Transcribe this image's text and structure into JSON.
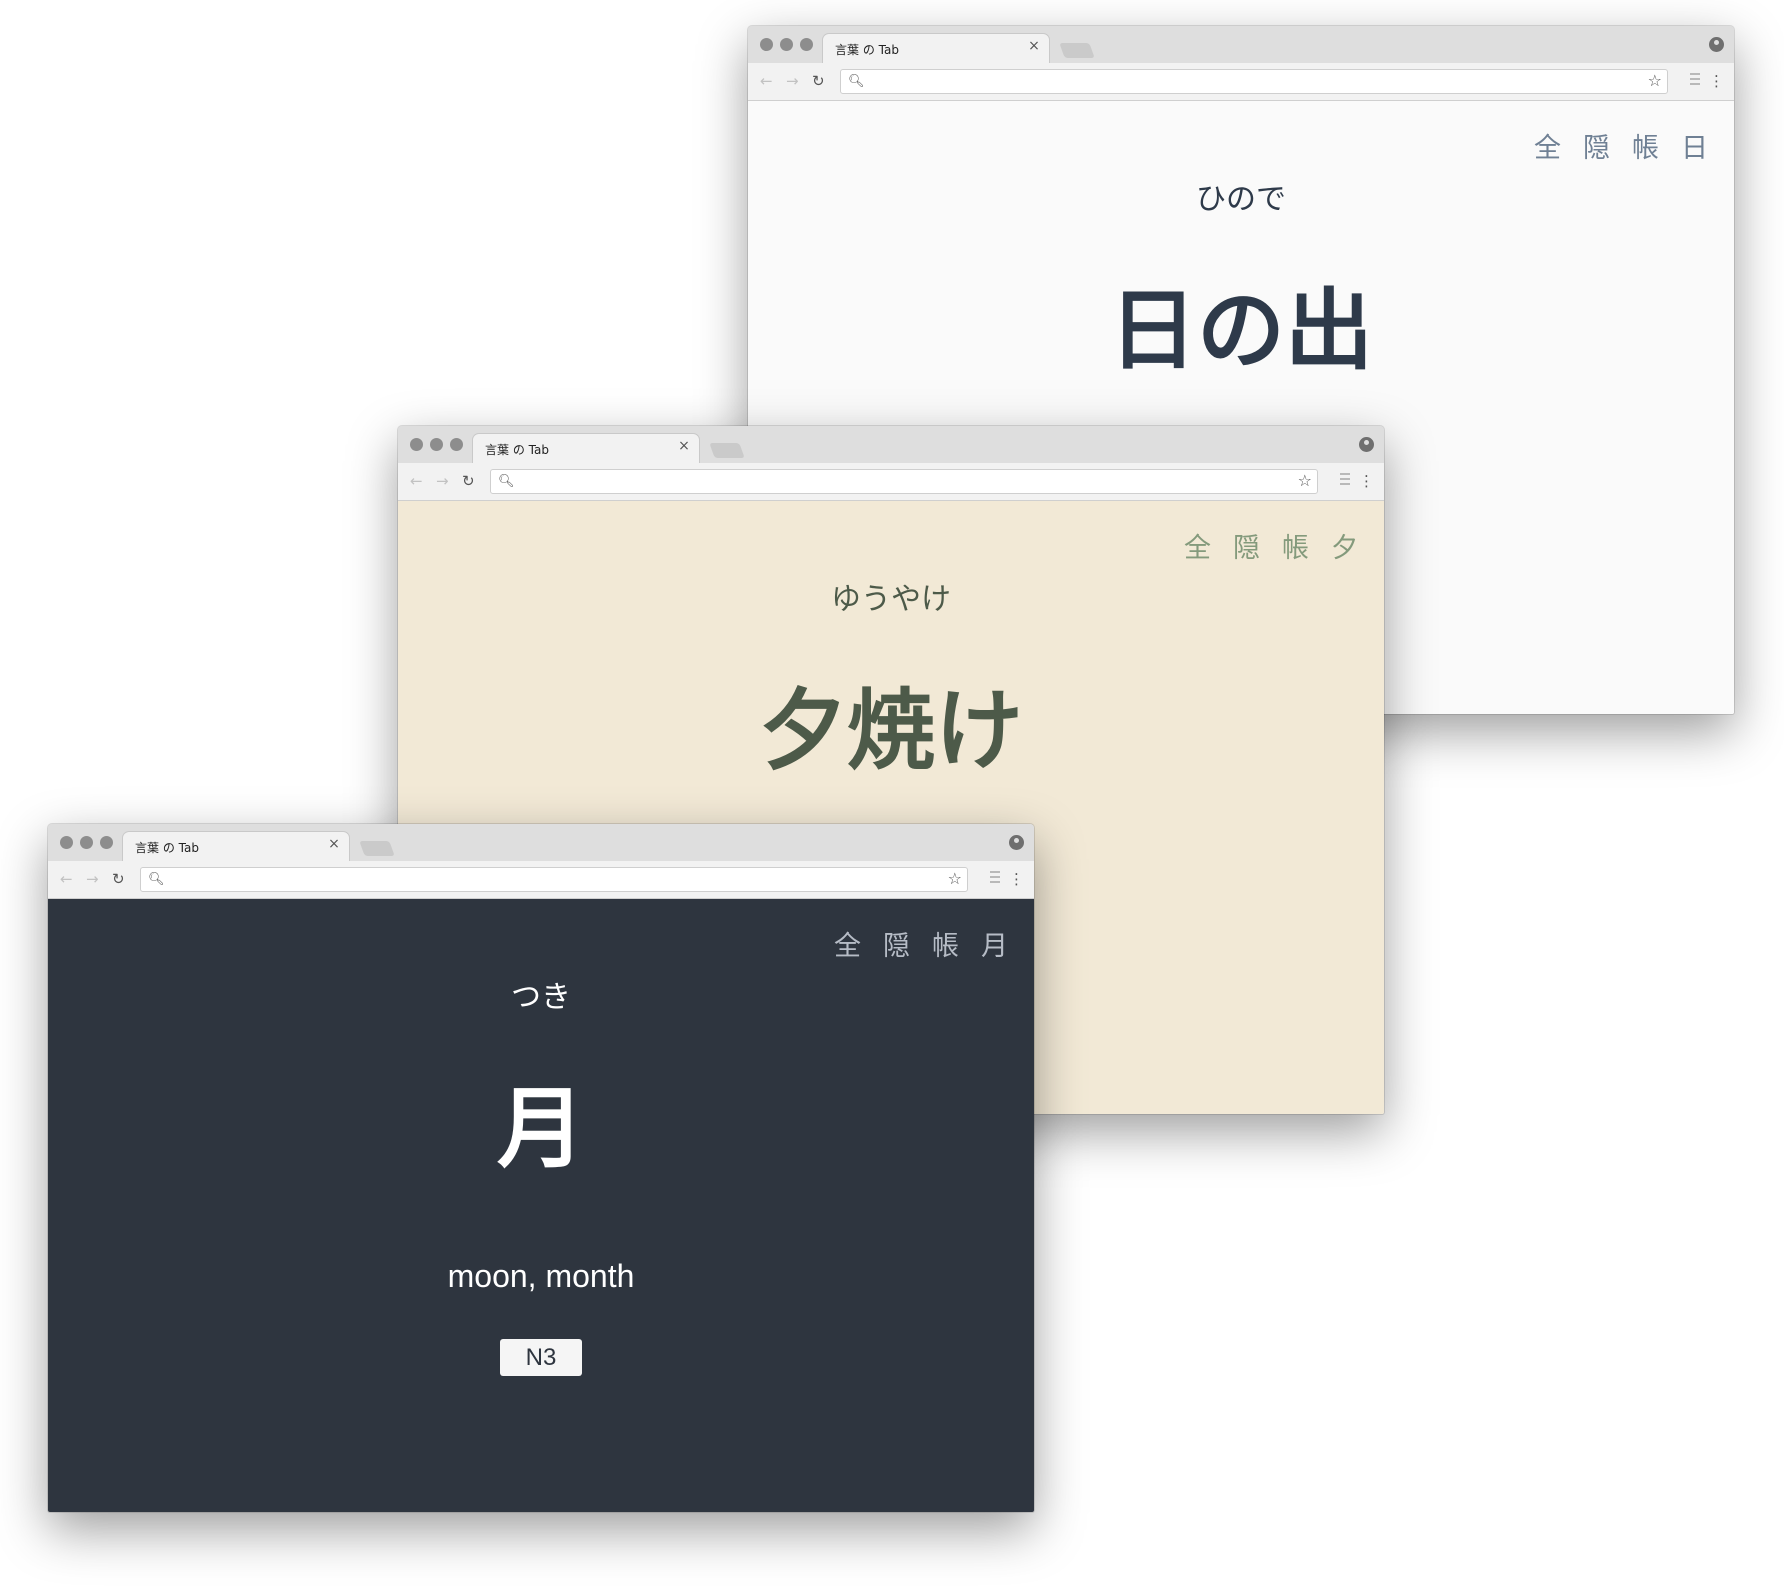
{
  "windows": [
    {
      "tab_title": "言葉 の Tab",
      "tab_close": "×",
      "shortcuts": [
        "全",
        "隠",
        "帳",
        "日"
      ],
      "reading": "ひので",
      "kanji": "日の出",
      "theme": {
        "background": "#fafafa",
        "text": "#2e3a4a",
        "shortcut_color": "#6f8094"
      }
    },
    {
      "tab_title": "言葉 の Tab",
      "tab_close": "×",
      "shortcuts": [
        "全",
        "隠",
        "帳",
        "夕"
      ],
      "reading": "ゆうやけ",
      "kanji": "夕焼け",
      "theme": {
        "background": "#f2e9d6",
        "text": "#4d5a49",
        "shortcut_color": "#849a7c"
      }
    },
    {
      "tab_title": "言葉 の Tab",
      "tab_close": "×",
      "shortcuts": [
        "全",
        "隠",
        "帳",
        "月"
      ],
      "reading": "つき",
      "kanji": "月",
      "meaning": "moon, month",
      "level": "N3",
      "theme": {
        "background": "#2e353f",
        "text": "#ffffff",
        "shortcut_color": "#b6bcc6"
      }
    }
  ],
  "toolbar_icons": {
    "back": "←",
    "forward": "→",
    "reload": "↻",
    "search": "🔍︎",
    "star": "☆",
    "menu": "⋮"
  }
}
